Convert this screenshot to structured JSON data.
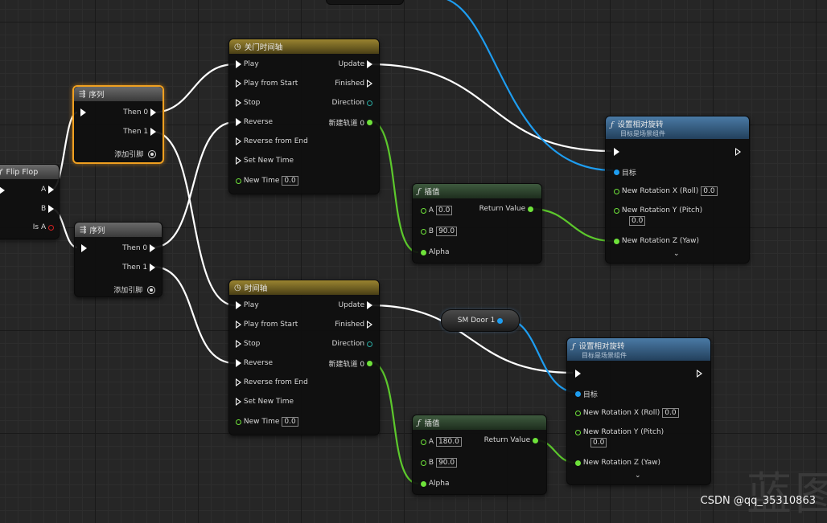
{
  "nodes": {
    "flipflop": {
      "title": "Flip Flop",
      "pin_a": "A",
      "pin_b": "B",
      "pin_is_a": "Is A"
    },
    "seq1": {
      "title": "序列",
      "then0": "Then 0",
      "then1": "Then 1",
      "add_pin": "添加引脚"
    },
    "seq2": {
      "title": "序列",
      "then0": "Then 0",
      "then1": "Then 1",
      "add_pin": "添加引脚"
    },
    "timeline1": {
      "title": "关门时间轴",
      "play": "Play",
      "play_from_start": "Play from Start",
      "stop": "Stop",
      "reverse": "Reverse",
      "reverse_from_end": "Reverse from End",
      "set_new_time": "Set New Time",
      "new_time": "New Time",
      "new_time_value": "0.0",
      "update": "Update",
      "finished": "Finished",
      "direction": "Direction",
      "track": "新建轨道 0"
    },
    "timeline2": {
      "title": "时间轴",
      "play": "Play",
      "play_from_start": "Play from Start",
      "stop": "Stop",
      "reverse": "Reverse",
      "reverse_from_end": "Reverse from End",
      "set_new_time": "Set New Time",
      "new_time": "New Time",
      "new_time_value": "0.0",
      "update": "Update",
      "finished": "Finished",
      "direction": "Direction",
      "track": "新建轨道 0"
    },
    "lerp1": {
      "title": "插值",
      "a": "A",
      "a_value": "0.0",
      "b": "B",
      "b_value": "90.0",
      "alpha": "Alpha",
      "return_value": "Return Value"
    },
    "lerp2": {
      "title": "插值",
      "a": "A",
      "a_value": "180.0",
      "b": "B",
      "b_value": "90.0",
      "alpha": "Alpha",
      "return_value": "Return Value"
    },
    "setrot1": {
      "title": "设置相对旋转",
      "subtitle": "目标是场景组件",
      "target": "目标",
      "rx": "New Rotation X (Roll)",
      "rx_value": "0.0",
      "ry": "New Rotation Y (Pitch)",
      "ry_value": "0.0",
      "rz": "New Rotation Z (Yaw)"
    },
    "setrot2": {
      "title": "设置相对旋转",
      "subtitle": "目标是场景组件",
      "target": "目标",
      "rx": "New Rotation X (Roll)",
      "rx_value": "0.0",
      "ry": "New Rotation Y (Pitch)",
      "ry_value": "0.0",
      "rz": "New Rotation Z (Yaw)"
    },
    "smdoor": {
      "label": "SM Door 1"
    }
  },
  "watermark": "CSDN @qq_35310863",
  "bg_text": "蓝图",
  "colors": {
    "exec": "#ffffff",
    "float": "#6ee23a",
    "object": "#1e9df0",
    "bool": "#d02020",
    "selected": "#f0a020"
  }
}
